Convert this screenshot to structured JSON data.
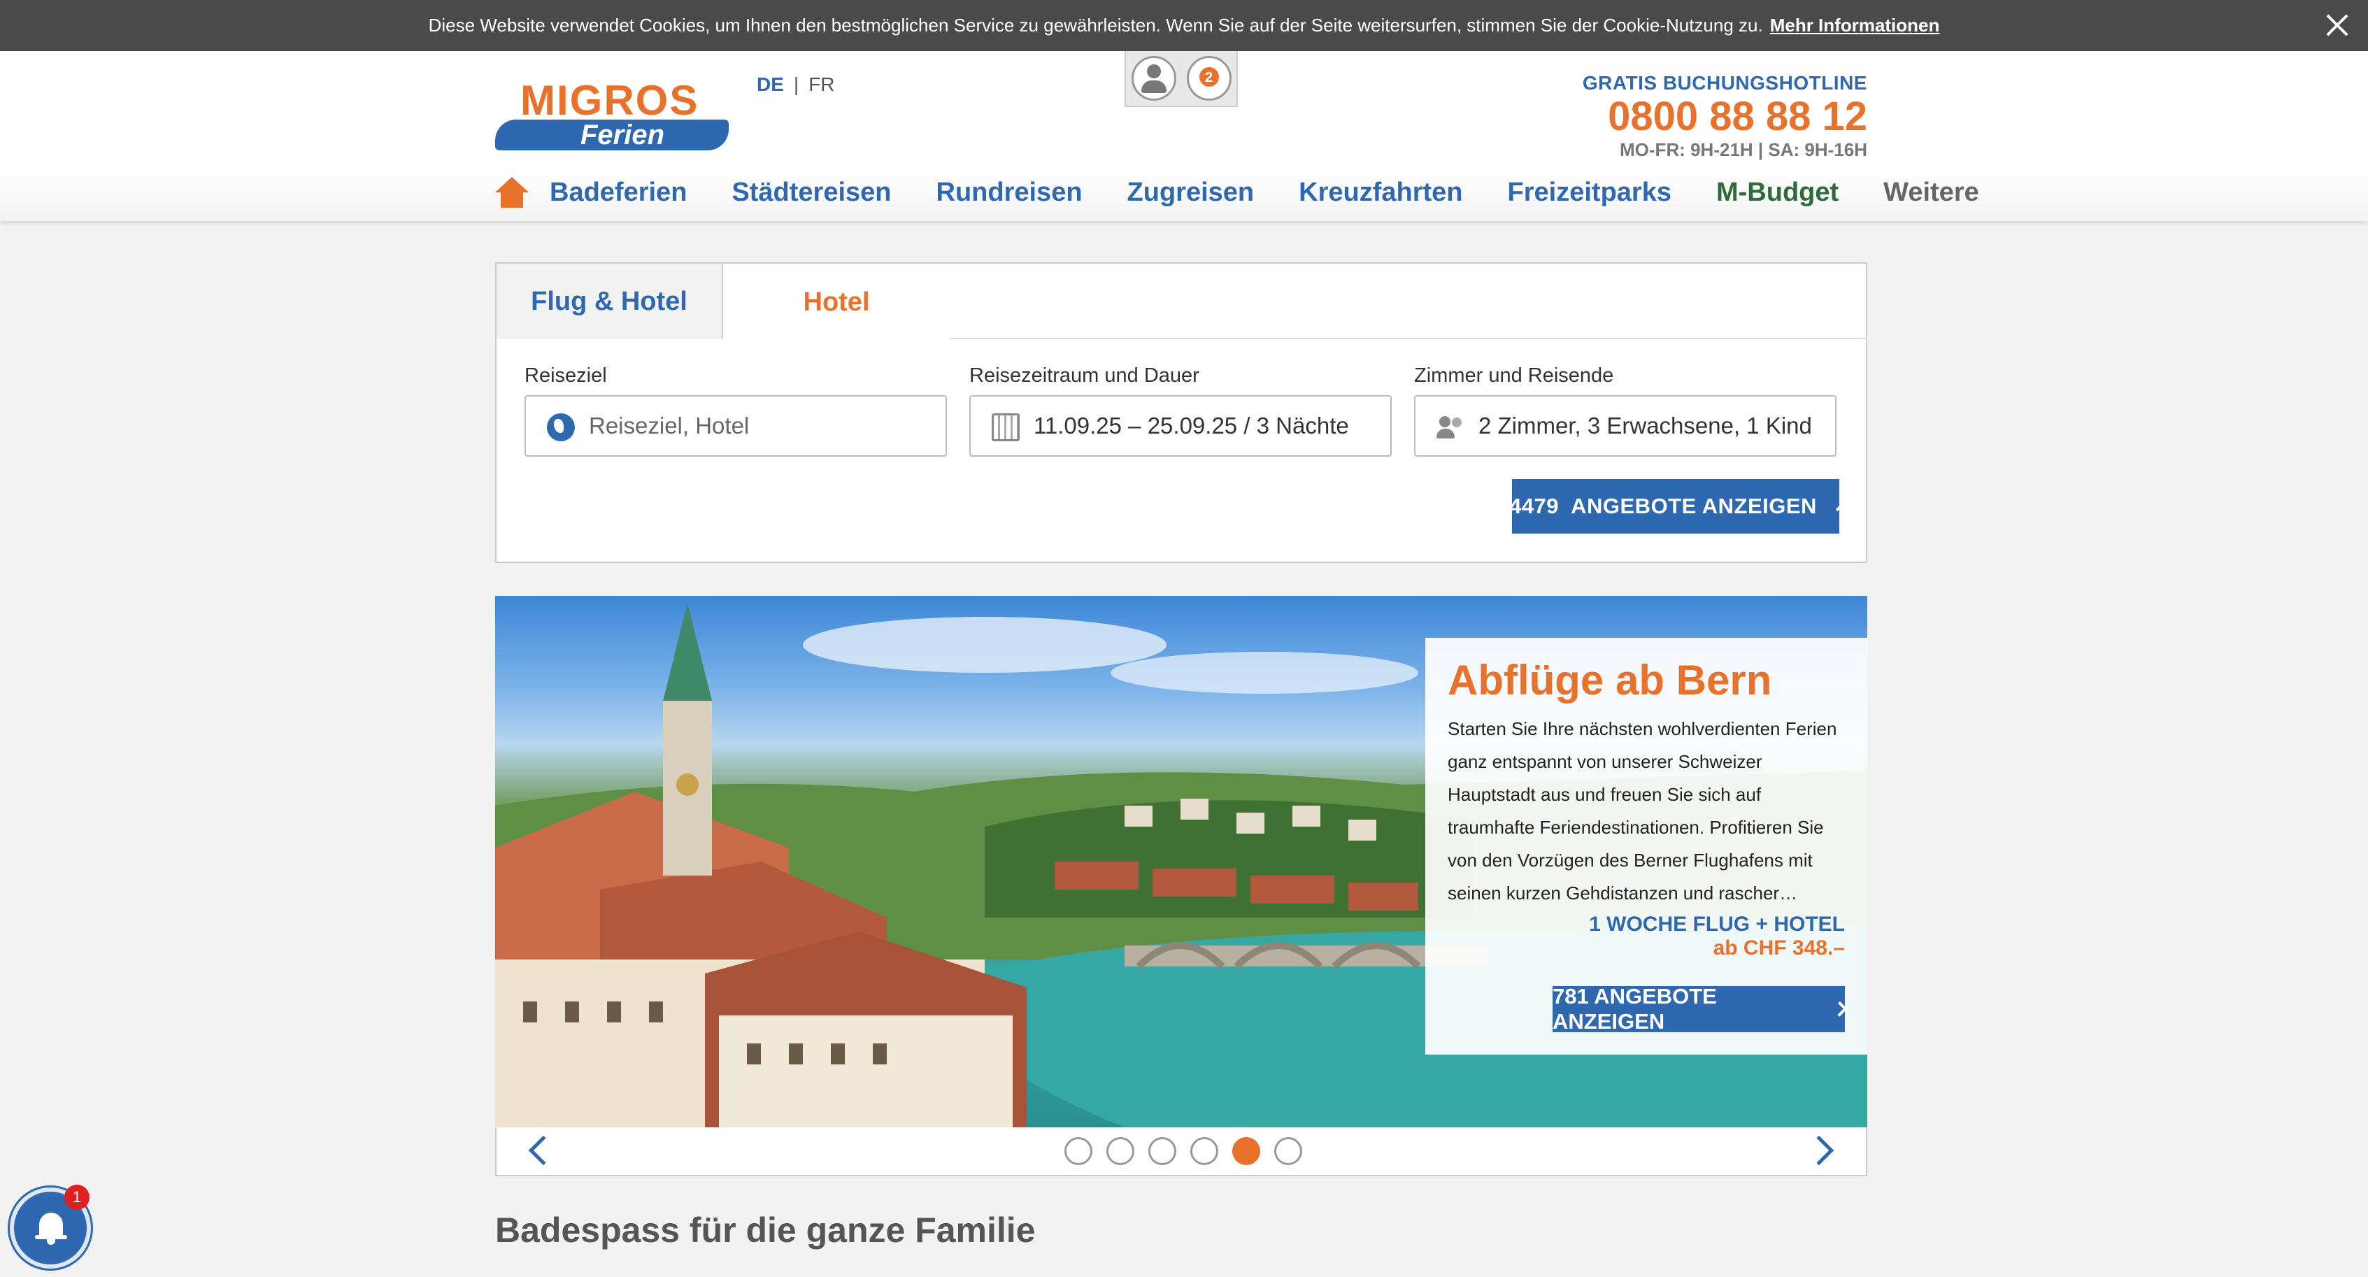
{
  "cookie": {
    "text": "Diese Website verwendet Cookies, um Ihnen den bestmöglichen Service zu gewährleisten. Wenn Sie auf der Seite weitersurfen, stimmen Sie der Cookie-Nutzung zu.",
    "link": "Mehr Informationen"
  },
  "header": {
    "logo_top": "MIGROS",
    "logo_bottom": "Ferien",
    "lang_de": "DE",
    "lang_sep": "|",
    "lang_fr": "FR",
    "favorites_count": "2",
    "hotline_label": "GRATIS BUCHUNGSHOTLINE",
    "hotline_number": "0800 88 88 12",
    "hotline_hours": "MO-FR: 9H-21H | SA: 9H-16H"
  },
  "nav": {
    "items": [
      "Badeferien",
      "Städtereisen",
      "Rundreisen",
      "Zugreisen",
      "Kreuzfahrten",
      "Freizeitparks",
      "M-Budget",
      "Weitere"
    ]
  },
  "search": {
    "tabs": [
      "Flug & Hotel",
      "Hotel"
    ],
    "label_ziel": "Reiseziel",
    "label_zeit": "Reisezeitraum und Dauer",
    "label_zimmer": "Zimmer und Reisende",
    "placeholder_ziel": "Reiseziel, Hotel",
    "value_zeit": "11.09.25 – 25.09.25 / 3 Nächte",
    "value_zimmer": "2 Zimmer, 3 Erwachsene, 1 Kind",
    "button": "4479  ANGEBOTE ANZEIGEN"
  },
  "slider": {
    "title": "Abflüge ab Bern",
    "text": "Starten Sie Ihre nächsten wohlverdienten Ferien ganz entspannt von unserer Schweizer Hauptstadt aus und freuen Sie sich auf traumhafte Feriendestinationen. Profitieren Sie von den Vorzügen des Berner Flughafens mit seinen kurzen Gehdistanzen und rascher…",
    "offer_line1": "1 WOCHE FLUG + HOTEL",
    "offer_line2": "ab CHF 348.–",
    "button": "781 ANGEBOTE ANZEIGEN",
    "dot_count": 6,
    "active_dot": 5
  },
  "section": {
    "title": "Badespass für die ganze Familie"
  },
  "notifications": {
    "count": "1"
  },
  "colors": {
    "brand_blue": "#2e68b0",
    "brand_orange": "#e8722b",
    "mbudget_green": "#2e6b3a"
  }
}
